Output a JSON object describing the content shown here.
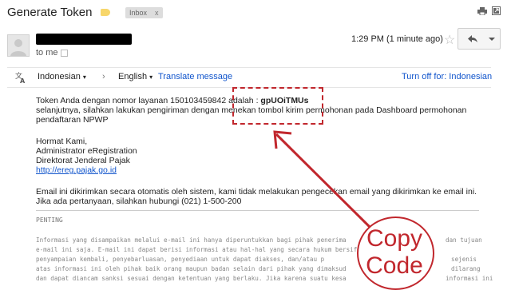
{
  "header": {
    "subject": "Generate Token",
    "label_chip": "Inbox",
    "label_chip_close": "x"
  },
  "message": {
    "sender_masked": "e••••••••••••••••••••••••••",
    "to": "to me",
    "time": "1:29 PM (1 minute ago)"
  },
  "translate_bar": {
    "source_lang": "Indonesian",
    "arrow": "›",
    "target_lang": "English",
    "translate_link": "Translate message",
    "turn_off": "Turn off for: Indonesian"
  },
  "body": {
    "line1_prefix": "Token Anda dengan nomor layanan 150103459842 adalah : ",
    "token": "gpUOiTMUs",
    "line2": "selanjutnya, silahkan lakukan pengiriman dengan menekan tombol kirim permohonan pada Dashboard permohonan",
    "line3": "pendaftaran NPWP",
    "greeting": "Hormat Kami,",
    "sig1": "Administrator eRegistration",
    "sig2": "Direktorat Jenderal Pajak",
    "sig_url": "http://ereg.pajak.go.id",
    "notice1": "Email ini dikirimkan secara otomatis oleh sistem, kami tidak melakukan pengecekan email yang dikirimkan ke email ini.",
    "notice2": "Jika ada pertanyaan, silahkan hubungi (021) 1-500-200",
    "penting": "PENTING",
    "fine1": "Informasi yang disampaikan melalui e-mail ini hanya diperuntukkan bagi pihak penerima",
    "fine1b": "dan tujuan",
    "fine2": "e-mail ini saja. E-mail ini dapat berisi informasi atau hal-hal yang secara hukum bersif",
    "fine3": "penyampaian kembali, penyebarluasan, penyediaan untuk dapat diakses, dan/atau p",
    "fine3b": "sejenis",
    "fine4": "atas informasi ini oleh pihak baik orang maupun badan selain dari pihak yang dimaksud",
    "fine4b": "dilarang",
    "fine5": "dan dapat diancam sanksi sesuai dengan ketentuan yang berlaku. Jika karena suatu kesa",
    "fine5b": "informasi ini"
  },
  "annotation": {
    "callout_line1": "Copy",
    "callout_line2": "Code",
    "color": "#c1272d"
  },
  "colors": {
    "link": "#1155cc",
    "label_tag": "#f7d66a"
  }
}
